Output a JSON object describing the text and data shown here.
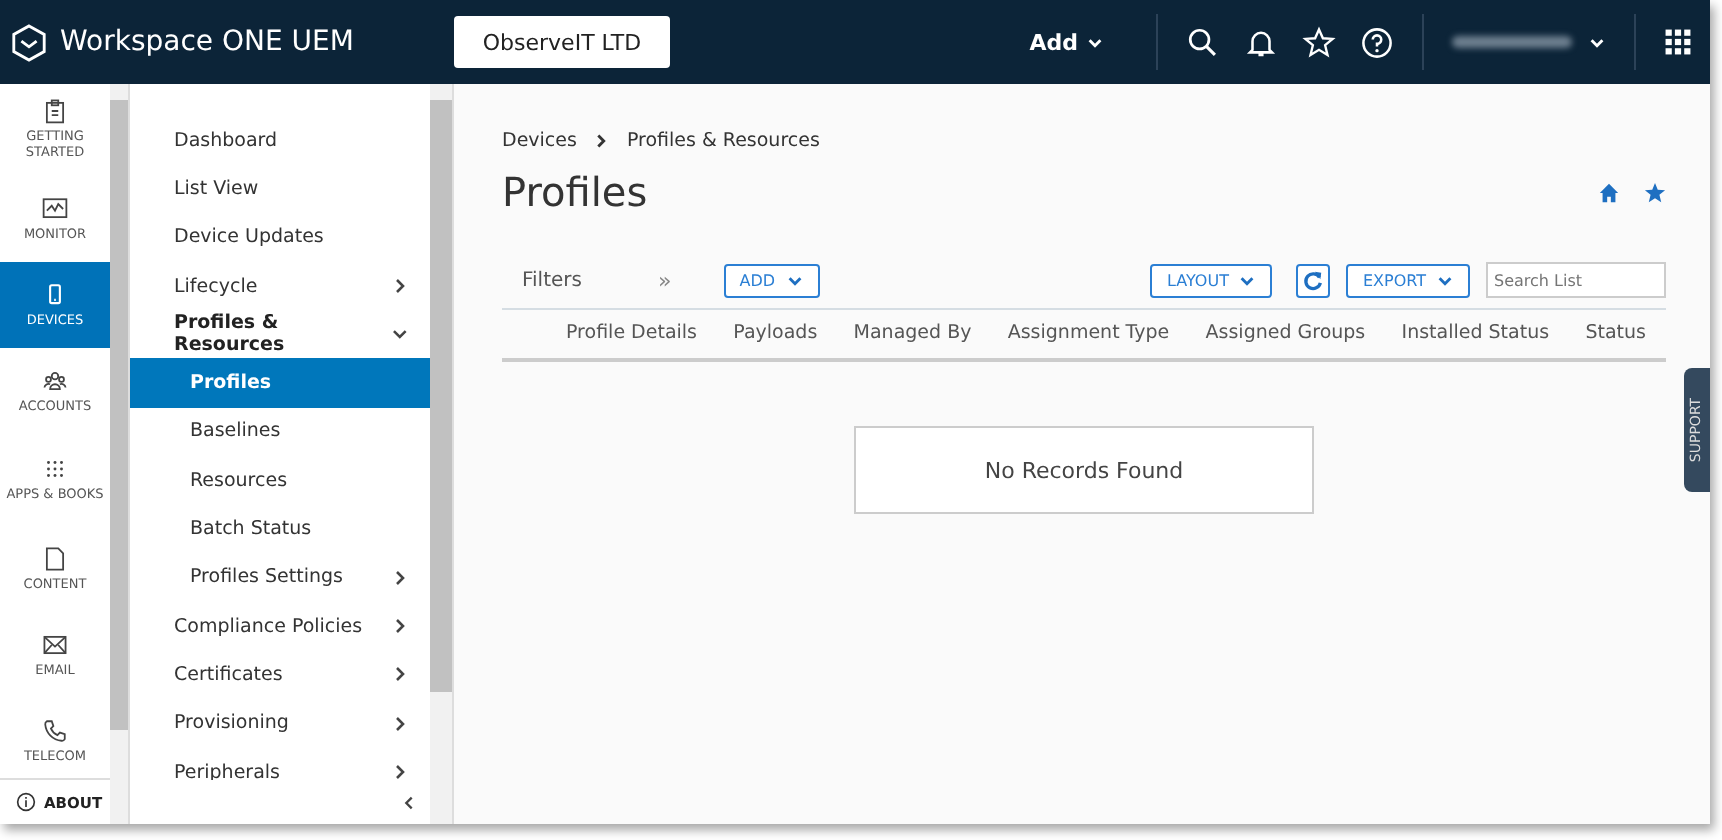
{
  "header": {
    "product": "Workspace ONE UEM",
    "org_button": "ObserveIT LTD",
    "add_menu": "Add"
  },
  "rail": {
    "items": [
      {
        "label": "GETTING STARTED",
        "selected": false
      },
      {
        "label": "MONITOR",
        "selected": false
      },
      {
        "label": "DEVICES",
        "selected": true
      },
      {
        "label": "ACCOUNTS",
        "selected": false
      },
      {
        "label": "APPS & BOOKS",
        "selected": false
      },
      {
        "label": "CONTENT",
        "selected": false
      },
      {
        "label": "EMAIL",
        "selected": false
      },
      {
        "label": "TELECOM",
        "selected": false
      }
    ],
    "about": "ABOUT"
  },
  "menu": {
    "items": [
      {
        "label": "Dashboard",
        "selected": false
      },
      {
        "label": "List View",
        "selected": false
      },
      {
        "label": "Device Updates",
        "selected": false
      },
      {
        "label": "Lifecycle",
        "selected": false,
        "expanded": false
      },
      {
        "label": "Profiles & Resources",
        "selected": false,
        "expanded": true,
        "children": [
          {
            "label": "Profiles",
            "selected": true
          },
          {
            "label": "Baselines",
            "selected": false
          },
          {
            "label": "Resources",
            "selected": false
          },
          {
            "label": "Batch Status",
            "selected": false
          },
          {
            "label": "Profiles Settings",
            "selected": false,
            "expanded": false
          }
        ]
      },
      {
        "label": "Compliance Policies",
        "selected": false,
        "expanded": false
      },
      {
        "label": "Certificates",
        "selected": false,
        "expanded": false
      },
      {
        "label": "Provisioning",
        "selected": false,
        "expanded": false
      },
      {
        "label": "Peripherals",
        "selected": false,
        "expanded": false
      }
    ]
  },
  "breadcrumb": [
    "Devices",
    "Profiles & Resources"
  ],
  "title": "Profiles",
  "toolbar": {
    "filters": "Filters",
    "collapse": "»",
    "add": "ADD",
    "layout": "LAYOUT",
    "export": "EXPORT",
    "search": {
      "placeholder": "Search List"
    }
  },
  "table": {
    "columns": [
      "Profile Details",
      "Payloads",
      "Managed By",
      "Assignment Type",
      "Assigned Groups",
      "Installed Status",
      "Status"
    ],
    "empty": "No Records Found"
  },
  "support": "SUPPORT"
}
